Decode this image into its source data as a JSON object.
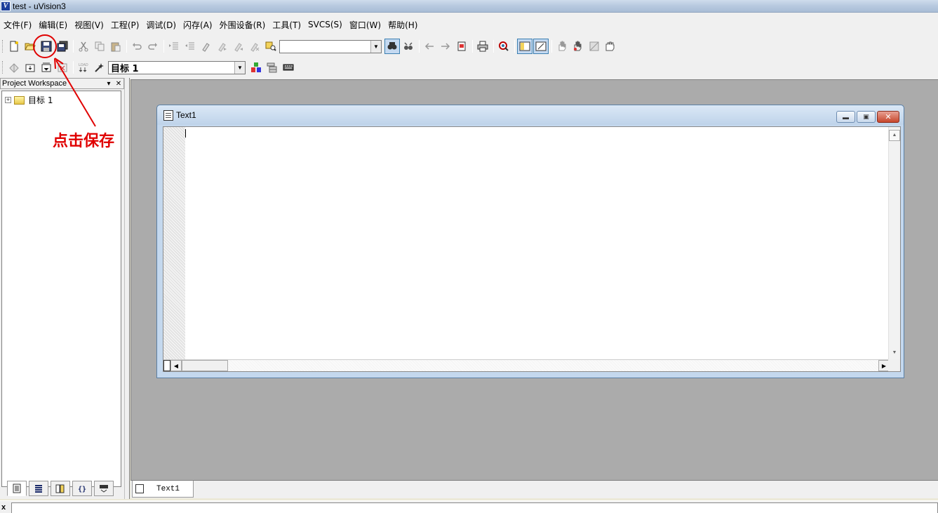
{
  "window": {
    "title": "test  - uVision3"
  },
  "menu": [
    "文件(F)",
    "编辑(E)",
    "视图(V)",
    "工程(P)",
    "调试(D)",
    "闪存(A)",
    "外围设备(R)",
    "工具(T)",
    "SVCS(S)",
    "窗口(W)",
    "帮助(H)"
  ],
  "toolbar": {
    "find_combo_value": "",
    "target_combo_value": "目标 1"
  },
  "workspace": {
    "title": "Project Workspace",
    "tree": [
      {
        "label": "目标 1",
        "expander": "+"
      }
    ]
  },
  "document": {
    "title": "Text1",
    "tab_label": "Text1"
  },
  "status": {
    "close_glyph": "x"
  },
  "annotation": {
    "text": "点击保存",
    "color": "#e00000"
  },
  "icons": {
    "toolbar1": [
      "new-file-icon",
      "open-folder-icon",
      "save-icon",
      "save-all-icon",
      "cut-icon",
      "copy-icon",
      "paste-icon",
      "undo-icon",
      "redo-icon",
      "indent-icon",
      "unindent-icon",
      "bookmark-icon",
      "next-bookmark-icon",
      "prev-bookmark-icon",
      "clear-bookmarks-icon",
      "find-in-files-icon",
      "find-icon",
      "incremental-find-icon",
      "back-icon",
      "forward-icon",
      "browse-icon",
      "print-icon",
      "debug-icon",
      "workspace-toggle-icon",
      "output-toggle-icon",
      "hand-icon",
      "multi-hand-icon",
      "grid-icon",
      "hand-grab-icon"
    ],
    "toolbar2": [
      "translate-icon",
      "build-icon",
      "rebuild-icon",
      "stop-build-icon",
      "download-icon",
      "options-icon",
      "components-icon",
      "manage-icon",
      "target-options-icon"
    ]
  }
}
